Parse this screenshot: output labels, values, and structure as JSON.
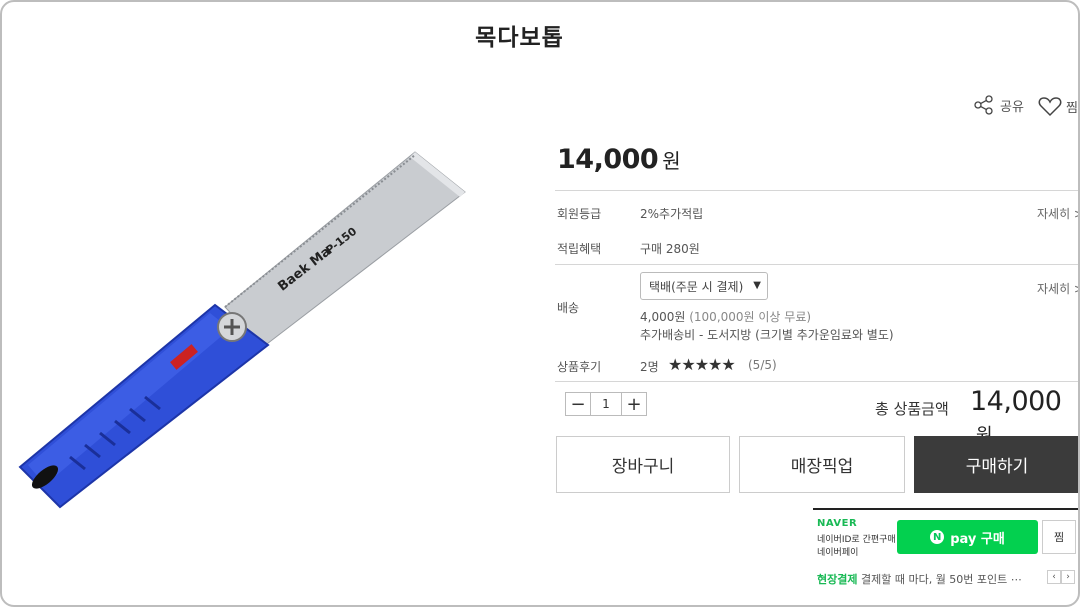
{
  "page_title": "목다보톱",
  "share_label": "공유",
  "wish_label": "찜",
  "price": {
    "amount": "14,000",
    "unit": "원"
  },
  "rows": {
    "member_grade": {
      "label": "회원등급",
      "value": "2%추가적립",
      "more": "자세히 >"
    },
    "points": {
      "label": "적립혜택",
      "value": "구매 280원"
    },
    "shipping": {
      "label": "배송",
      "select_value": "택배(주문 시 결제)",
      "fee": "4,000원",
      "free_note": "(100,000원 이상 무료)",
      "extra": "추가배송비 - 도서지방 (크기별 추가운임료와 별도)",
      "more": "자세히 >"
    },
    "review": {
      "label": "상품후기",
      "count": "2명",
      "stars": "★★★★★",
      "score": "(5/5)"
    }
  },
  "quantity": {
    "minus": "−",
    "value": "1",
    "plus": "+"
  },
  "total": {
    "label": "총 상품금액",
    "amount": "14,000",
    "unit": "원"
  },
  "buttons": {
    "cart": "장바구니",
    "pickup": "매장픽업",
    "buy": "구매하기"
  },
  "naver": {
    "logo": "NAVER",
    "line1": "네이버ID로 간편구매",
    "line2": "네이버페이",
    "pay_n": "N",
    "pay_label": "pay 구매",
    "zzim": "찜"
  },
  "onsite": {
    "highlight": "현장결제",
    "text": "결제할 때 마다, 월 50번 포인트 ⋯"
  },
  "image_text": {
    "brand": "Baek Ma",
    "model": "P-150"
  },
  "colors": {
    "handle_blue": "#2f4fd8",
    "npay_green": "#03d04f",
    "buy_dark": "#3b3b3b"
  }
}
